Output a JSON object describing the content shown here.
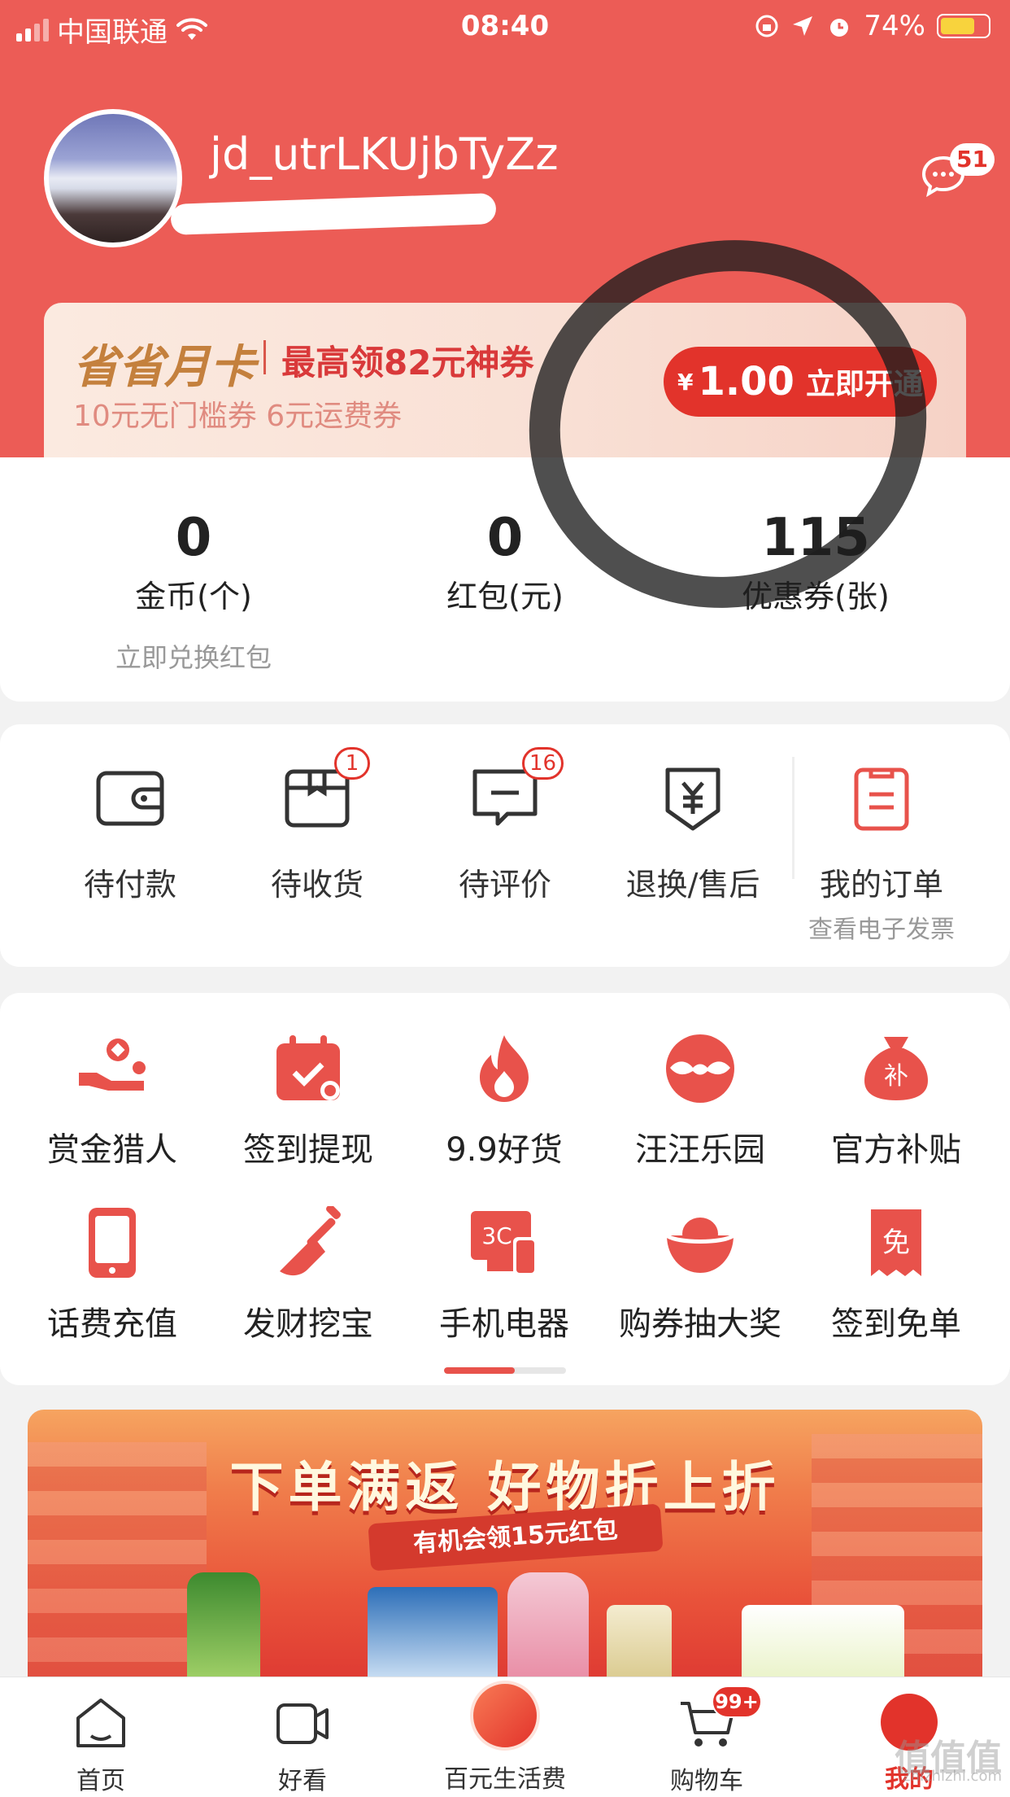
{
  "status_bar": {
    "carrier": "中国联通",
    "time": "08:40",
    "battery": "74%",
    "battery_level": 0.74
  },
  "profile": {
    "username": "jd_utrLKUjbTyZz",
    "message_count": "51"
  },
  "promo": {
    "brand": "省省月卡",
    "title": "最高领82元神券",
    "subtitle": "10元无门槛券 6元运费券",
    "currency": "¥",
    "price": "1.00",
    "cta": "立即开通"
  },
  "assets": [
    {
      "value": "0",
      "label": "金币(个)",
      "sub": "立即兑换红包"
    },
    {
      "value": "0",
      "label": "红包(元)"
    },
    {
      "value": "115",
      "label": "优惠券(张)"
    }
  ],
  "orders": {
    "items": [
      {
        "label": "待付款",
        "icon": "wallet-icon"
      },
      {
        "label": "待收货",
        "icon": "package-icon",
        "badge": "1"
      },
      {
        "label": "待评价",
        "icon": "comment-icon",
        "badge": "16"
      },
      {
        "label": "退换/售后",
        "icon": "refund-icon"
      }
    ],
    "all": {
      "label": "我的订单",
      "sub": "查看电子发票",
      "icon": "order-list-icon"
    }
  },
  "tools": [
    {
      "label": "赏金猎人",
      "icon": "bounty-hand-icon"
    },
    {
      "label": "签到提现",
      "icon": "calendar-check-icon"
    },
    {
      "label": "9.9好货",
      "icon": "flame-icon"
    },
    {
      "label": "汪汪乐园",
      "icon": "dog-face-icon"
    },
    {
      "label": "官方补贴",
      "icon": "money-bag-icon",
      "glyph": "补"
    },
    {
      "label": "话费充值",
      "icon": "phone-icon"
    },
    {
      "label": "发财挖宝",
      "icon": "shovel-icon"
    },
    {
      "label": "手机电器",
      "icon": "electronics-3c-icon",
      "glyph": "3C"
    },
    {
      "label": "购券抽大奖",
      "icon": "gold-ingot-icon"
    },
    {
      "label": "签到免单",
      "icon": "free-ticket-icon",
      "glyph": "免"
    }
  ],
  "banner": {
    "title": "下单满返 好物折上折",
    "ribbon": "有机会领15元红包"
  },
  "tabbar": [
    {
      "label": "首页",
      "icon": "home-icon"
    },
    {
      "label": "好看",
      "icon": "video-icon"
    },
    {
      "label": "百元生活费",
      "icon": "red-envelope-icon"
    },
    {
      "label": "购物车",
      "icon": "cart-icon",
      "badge": "99+"
    },
    {
      "label": "我的",
      "icon": "me-icon"
    }
  ],
  "watermark": {
    "text": "值值值",
    "sub": "zhizhizhi.com"
  },
  "colors": {
    "brand_red": "#e2332b",
    "header_bg": "#ec5c56",
    "icon_red": "#e8524b"
  }
}
